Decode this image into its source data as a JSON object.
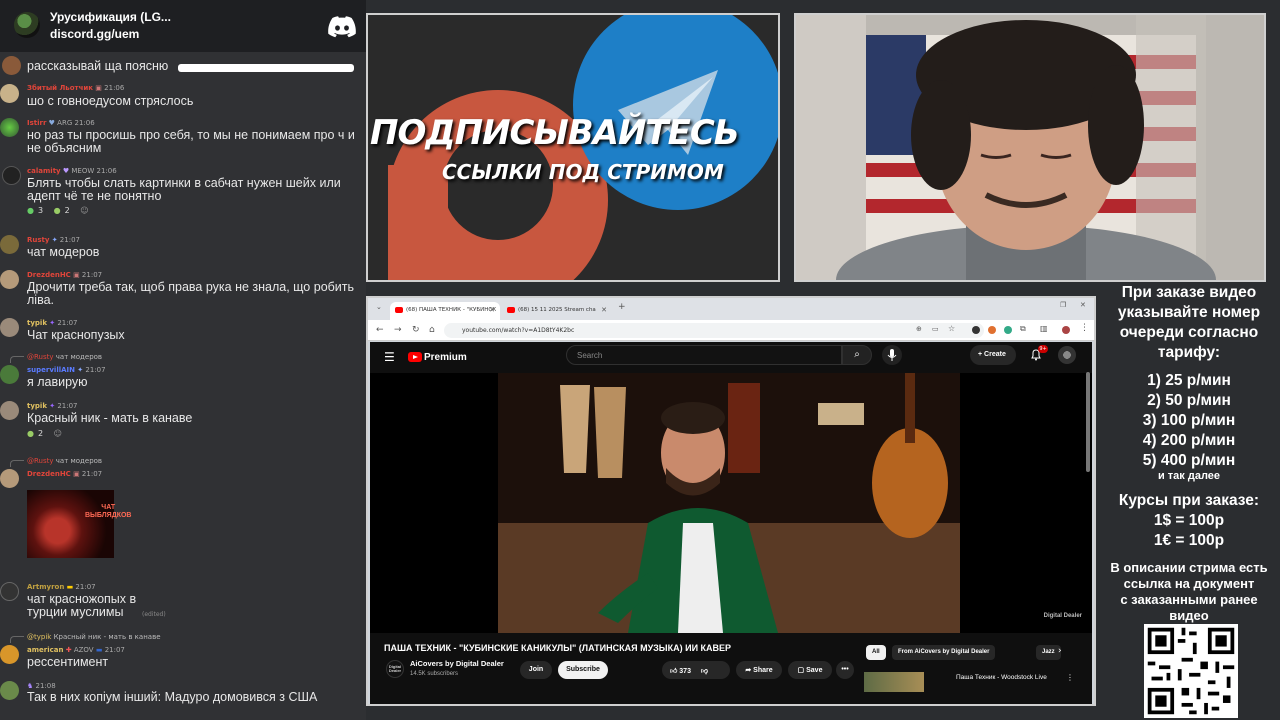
{
  "discord": {
    "server_name": "Урусификация (LG...",
    "invite": "discord.gg/uem"
  },
  "chat": [
    {
      "user": "",
      "time": "",
      "text": "рассказывай ща поясню",
      "user_color": "#ff6666"
    },
    {
      "user": "Збитый Льотчик",
      "time": "21:06",
      "text": "шо с говноедусом стряслось",
      "user_color": "#e0453a"
    },
    {
      "user": "Istirr",
      "badge": "ARG",
      "time": "21:06",
      "text": "но раз ты просишь про себя, то мы не понимаем про ч и не объясним",
      "user_color": "#e0453a"
    },
    {
      "user": "calamity",
      "badge": "MEOW",
      "time": "21:06",
      "text": "Блять чтобы слать картинки в сабчат нужен шейх или адепт чё те не понятно",
      "user_color": "#e0453a",
      "reactions": [
        "3",
        "2"
      ]
    },
    {
      "user": "Rusty",
      "time": "21:07",
      "text": "чат модеров",
      "user_color": "#e0453a"
    },
    {
      "user": "DrezdenHC",
      "time": "21:07",
      "text": "Дрочити треба так, щоб права рука не знала, що робить ліва.",
      "user_color": "#e0453a"
    },
    {
      "user": "typik",
      "time": "21:07",
      "text": "Чат краснопузых",
      "user_color": "#e0c060"
    },
    {
      "reply_user": "@Rusty",
      "reply_text": "чат модеров",
      "user": "supervillAIN",
      "time": "21:07",
      "text": "я лавирую",
      "user_color": "#5a7bff"
    },
    {
      "user": "typik",
      "time": "21:07",
      "text": "Красный ник - мать в канаве",
      "user_color": "#e0c060",
      "reactions": [
        "2"
      ]
    },
    {
      "reply_user": "@Rusty",
      "reply_text": "чат модеров",
      "user": "DrezdenHC",
      "time": "21:07",
      "text": "",
      "user_color": "#e0453a",
      "image_text": "ЧАТ ВЫБЛЯДКОВ"
    },
    {
      "user": "Artmyron",
      "time": "21:07",
      "text": "чат красножопых в турции муслимы",
      "edited": "(edited)",
      "user_color": "#c0a040"
    },
    {
      "reply_user": "@typik",
      "reply_text": "Красный ник - мать в канаве",
      "user": "american",
      "badge": "AZOV",
      "time": "21:07",
      "text": "рессентимент",
      "user_color": "#e0c060"
    },
    {
      "user": "",
      "time": "21:08",
      "text": "Так в них копіум інший: Мадуро домовився з США",
      "user_color": "#aaaaaa"
    }
  ],
  "banner": {
    "title": "ПОДПИСЫВАЙТЕСЬ",
    "subtitle": "ССЫЛКИ ПОД СТРИМОМ"
  },
  "browser": {
    "tabs": [
      {
        "label": "(68) ПАША ТЕХНИК - \"КУБИНСК",
        "active": true
      },
      {
        "label": "(68) 15 11 2025 Stream cha",
        "active": false
      }
    ],
    "url": "youtube.com/watch?v=A1D8tY4K2bc"
  },
  "youtube": {
    "brand": "Premium",
    "search_placeholder": "Search",
    "create_label": "Create",
    "notif_count": "9+",
    "video_title": "ПАША ТЕХНИК - \"КУБИНСКИЕ КАНИКУЛЫ\" (ЛАТИНСКАЯ МУЗЫКА) ИИ КАВЕР",
    "channel": "AiCovers by Digital Dealer",
    "channel_avatar_text": "Digital Dealer",
    "subscribers": "14.5K subscribers",
    "join": "Join",
    "subscribe": "Subscribe",
    "likes": "373",
    "share": "Share",
    "save": "Save",
    "more": "•••",
    "chips": [
      "All",
      "From AiCovers by Digital Dealer",
      "Jazz"
    ],
    "rec_title": "Паша Техник - Woodstock Live",
    "watermark": "Digital Dealer"
  },
  "info": {
    "lines_big": [
      "При заказе видео",
      "указывайте номер",
      "очереди согласно",
      "тарифу:"
    ],
    "tariffs": [
      "1) 25 р/мин",
      "2) 50 р/мин",
      "3) 100 р/мин",
      "4) 200 р/мин",
      "5) 400 р/мин"
    ],
    "etc": "и так далее",
    "rates_title": "Курсы при заказе:",
    "rates": [
      "1$ = 100р",
      "1€ = 100р"
    ],
    "desc": [
      "В описании стрима есть",
      "ссылка на документ",
      "с заказанными ранее",
      "видео"
    ]
  }
}
